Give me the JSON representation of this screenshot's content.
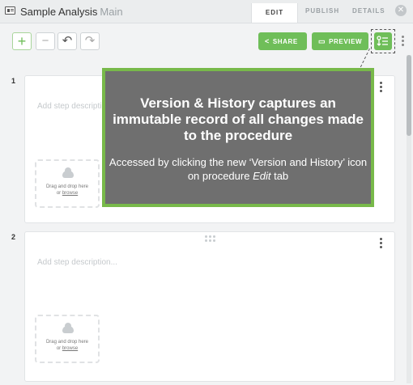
{
  "header": {
    "app_icon": "procedure-icon",
    "title": "Sample Analysis",
    "subtitle": "Main",
    "tabs": [
      "EDIT",
      "PUBLISH",
      "DETAILS"
    ],
    "active_tab": "EDIT",
    "close_icon": "close-icon"
  },
  "toolbar": {
    "add_symbol": "+",
    "remove_symbol": "−",
    "undo_symbol": "↶",
    "redo_symbol": "↷",
    "share_label": "SHARE",
    "preview_label": "PREVIEW",
    "accent_color": "#6fbe59"
  },
  "steps": [
    {
      "number": "1",
      "placeholder": "Add step description...",
      "drop_text": "Drag and drop here",
      "drop_or": "or",
      "drop_link": "browse"
    },
    {
      "number": "2",
      "placeholder": "Add step description...",
      "drop_text": "Drag and drop here",
      "drop_or": "or",
      "drop_link": "browse"
    }
  ],
  "callout": {
    "headline": "Version & History captures an immutable record of all changes made to the procedure",
    "body_prefix": "Accessed by clicking the new ‘Version and History’ icon on procedure ",
    "body_emph": "Edit",
    "body_suffix": " tab",
    "border_color": "#78b94a"
  }
}
